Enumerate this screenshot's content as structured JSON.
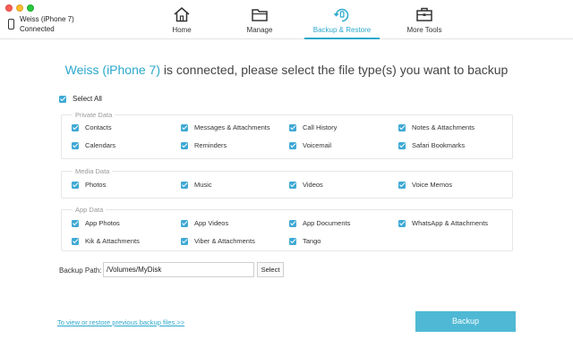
{
  "device": {
    "name": "Weiss (iPhone 7)",
    "status": "Connected"
  },
  "nav": [
    {
      "label": "Home",
      "icon": "home-icon"
    },
    {
      "label": "Manage",
      "icon": "folder-icon"
    },
    {
      "label": "Backup & Restore",
      "icon": "backup-restore-icon",
      "active": true
    },
    {
      "label": "More Tools",
      "icon": "toolbox-icon"
    }
  ],
  "headline": {
    "device": "Weiss (iPhone 7)",
    "text": " is connected, please select the file type(s) you want to backup"
  },
  "select_all": "Select All",
  "groups": [
    {
      "title": "Private Data",
      "items": [
        "Contacts",
        "Messages & Attachments",
        "Call History",
        "Notes & Attachments",
        "Calendars",
        "Reminders",
        "Voicemail",
        "Safari Bookmarks"
      ]
    },
    {
      "title": "Media Data",
      "items": [
        "Photos",
        "Music",
        "Videos",
        "Voice Memos"
      ]
    },
    {
      "title": "App Data",
      "items": [
        "App Photos",
        "App Videos",
        "App Documents",
        "WhatsApp & Attachments",
        "Kik & Attachments",
        "Viber & Attachments",
        "Tango"
      ]
    }
  ],
  "backup_path": {
    "label": "Backup Path:",
    "value": "/Volumes/MyDisk",
    "select_label": "Select"
  },
  "footer": {
    "link": "To view or restore previous backup files.>>",
    "backup_button": "Backup"
  },
  "colors": {
    "accent": "#2ba8cc",
    "checkbox": "#3fa9d4",
    "button": "#4fb9d5"
  }
}
